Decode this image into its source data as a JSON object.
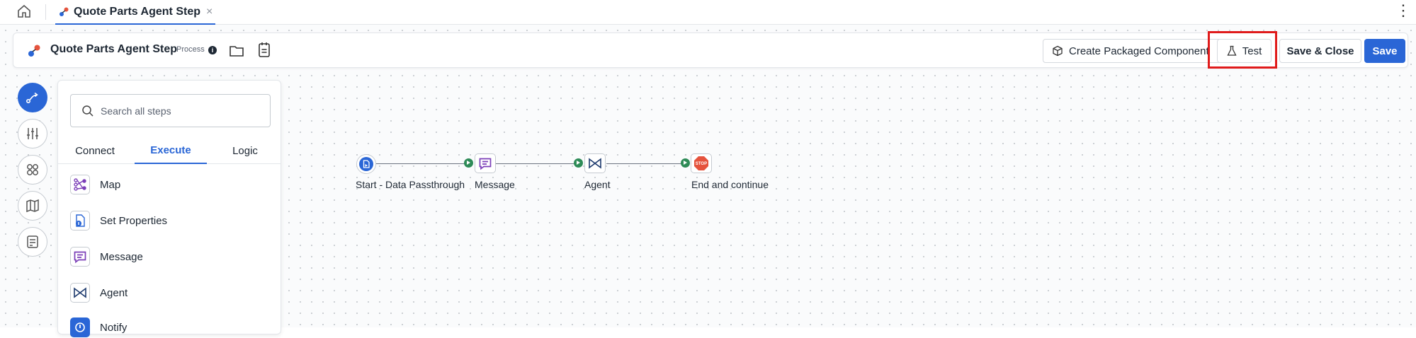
{
  "tabbar": {
    "tab_label": "Quote Parts Agent Step",
    "tab_close": "×",
    "more_icon": "⋮"
  },
  "toolbar": {
    "title": "Quote Parts Agent Step",
    "type_label": "Process",
    "info_glyph": "i",
    "create_packaged_label": "Create Packaged Component",
    "test_label": "Test",
    "save_close_label": "Save & Close",
    "save_label": "Save"
  },
  "rail": {
    "items": [
      "flow-icon",
      "sliders-icon",
      "grid-icon",
      "map-icon",
      "notes-icon"
    ]
  },
  "panel": {
    "search_placeholder": "Search all steps",
    "tabs": [
      "Connect",
      "Execute",
      "Logic"
    ],
    "active_tab": "Execute",
    "items": [
      {
        "label": "Map",
        "icon": "map-shape-icon"
      },
      {
        "label": "Set Properties",
        "icon": "set-properties-icon"
      },
      {
        "label": "Message",
        "icon": "message-icon"
      },
      {
        "label": "Agent",
        "icon": "agent-icon"
      },
      {
        "label": "Notify",
        "icon": "notify-icon"
      }
    ]
  },
  "flow": {
    "nodes": [
      {
        "label": "Start - Data Passthrough",
        "icon": "start-icon"
      },
      {
        "label": "Message",
        "icon": "message-icon"
      },
      {
        "label": "Agent",
        "icon": "agent-icon"
      },
      {
        "label": "End and continue",
        "icon": "stop-icon",
        "badge": "STOP"
      }
    ]
  },
  "colors": {
    "accent": "#2a66d6",
    "highlight": "#e01b1b",
    "port": "#2e8b57",
    "message": "#7b3fb8",
    "stop": "#e5533d"
  }
}
